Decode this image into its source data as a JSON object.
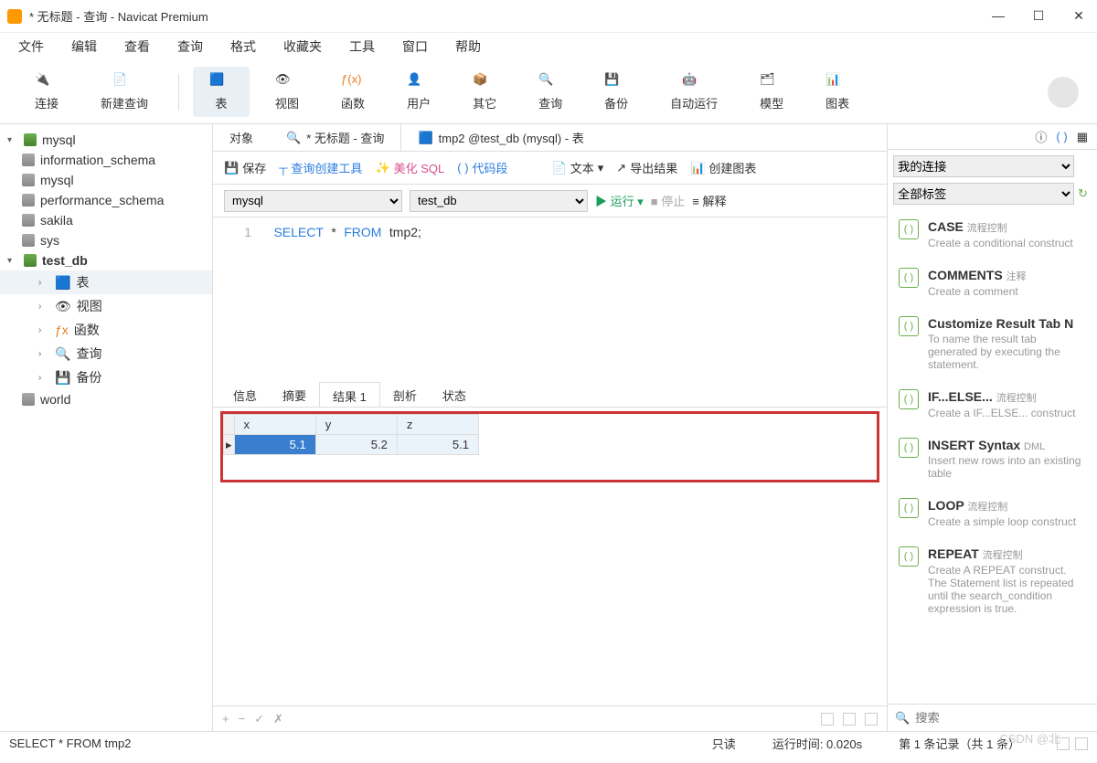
{
  "title": "* 无标题 - 查询 - Navicat Premium",
  "menu": [
    "文件",
    "编辑",
    "查看",
    "查询",
    "格式",
    "收藏夹",
    "工具",
    "窗口",
    "帮助"
  ],
  "toolbar": [
    {
      "label": "连接"
    },
    {
      "label": "新建查询"
    },
    {
      "label": "表"
    },
    {
      "label": "视图"
    },
    {
      "label": "函数"
    },
    {
      "label": "用户"
    },
    {
      "label": "其它"
    },
    {
      "label": "查询"
    },
    {
      "label": "备份"
    },
    {
      "label": "自动运行"
    },
    {
      "label": "模型"
    },
    {
      "label": "图表"
    }
  ],
  "tree": {
    "root": "mysql",
    "dbs": [
      "information_schema",
      "mysql",
      "performance_schema",
      "sakila",
      "sys"
    ],
    "active_db": "test_db",
    "children": [
      "表",
      "视图",
      "函数",
      "查询",
      "备份"
    ],
    "extra": "world"
  },
  "tabs": [
    "对象",
    "* 无标题 - 查询",
    "tmp2 @test_db (mysql) - 表"
  ],
  "qtoolbar": {
    "save": "保存",
    "tool": "查询创建工具",
    "beautify": "美化 SQL",
    "snippet": "代码段",
    "text": "文本",
    "export": "导出结果",
    "chart": "创建图表"
  },
  "conn": {
    "c": "mysql",
    "db": "test_db",
    "run": "运行",
    "stop": "停止",
    "explain": "解释"
  },
  "sql": {
    "line": "1",
    "kw1": "SELECT",
    "star": "*",
    "kw2": "FROM",
    "tbl": "tmp2;"
  },
  "result_tabs": [
    "信息",
    "摘要",
    "结果 1",
    "剖析",
    "状态"
  ],
  "grid": {
    "cols": [
      "x",
      "y",
      "z"
    ],
    "row": [
      "5.1",
      "5.2",
      "5.1"
    ]
  },
  "right": {
    "conn": "我的连接",
    "tags": "全部标签",
    "search_ph": "搜索"
  },
  "snippets": [
    {
      "t": "CASE",
      "sub": "流程控制",
      "d": "Create a conditional construct"
    },
    {
      "t": "COMMENTS",
      "sub": "注释",
      "d": "Create a comment"
    },
    {
      "t": "Customize Result Tab N",
      "sub": "",
      "d": "To name the result tab generated by executing the statement."
    },
    {
      "t": "IF...ELSE...",
      "sub": "流程控制",
      "d": "Create a IF...ELSE... construct"
    },
    {
      "t": "INSERT Syntax",
      "sub": "DML",
      "d": "Insert new rows into an existing table"
    },
    {
      "t": "LOOP",
      "sub": "流程控制",
      "d": "Create a simple loop construct"
    },
    {
      "t": "REPEAT",
      "sub": "流程控制",
      "d": "Create A REPEAT construct. The Statement list is repeated until the search_condition expression is true."
    }
  ],
  "status": {
    "sql": "SELECT * FROM tmp2",
    "ro": "只读",
    "time": "运行时间: 0.020s",
    "rec": "第 1 条记录（共 1 条）"
  },
  "watermark": "CSDN @北"
}
